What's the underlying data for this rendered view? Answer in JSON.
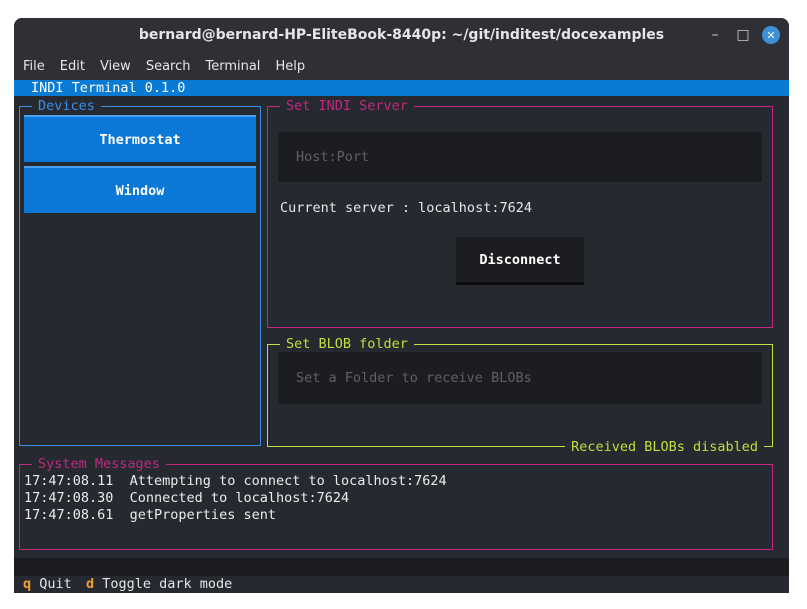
{
  "window": {
    "title": "bernard@bernard-HP-EliteBook-8440p: ~/git/inditest/docexamples",
    "controls": {
      "minimize": "–",
      "maximize": "□",
      "close": "✕"
    }
  },
  "menu": [
    "File",
    "Edit",
    "View",
    "Search",
    "Terminal",
    "Help"
  ],
  "app": {
    "title": "INDI Terminal 0.1.0",
    "devices": {
      "legend": "Devices",
      "items": [
        "Thermostat",
        "Window"
      ]
    },
    "server": {
      "legend": "Set INDI Server",
      "input_placeholder": "Host:Port",
      "current_label": "Current server : localhost:7624",
      "disconnect_label": "Disconnect"
    },
    "blob": {
      "legend": "Set BLOB folder",
      "input_placeholder": "Set a Folder to receive BLOBs",
      "status": "Received BLOBs disabled"
    },
    "system_messages": {
      "legend": "System Messages",
      "lines": [
        "17:47:08.11  Attempting to connect to localhost:7624",
        "17:47:08.30  Connected to localhost:7624",
        "17:47:08.61  getProperties sent"
      ]
    },
    "footer": {
      "quit_key": "q",
      "quit_label": "Quit",
      "dark_key": "d",
      "dark_label": "Toggle dark mode"
    }
  },
  "colors": {
    "accent_blue": "#0a7bd5",
    "server_border": "#c2297f",
    "blob_border": "#bde33c",
    "footer_key": "#f0a030"
  }
}
